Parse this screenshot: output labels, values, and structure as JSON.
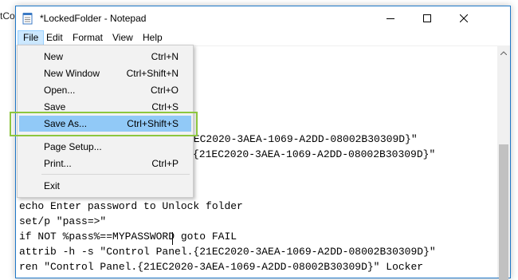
{
  "background": {
    "text": "tCo"
  },
  "window": {
    "title": "*LockedFolder - Notepad",
    "controls": {
      "minimize": "—",
      "maximize": "☐",
      "close": "✕"
    }
  },
  "menubar": {
    "items": [
      "File",
      "Edit",
      "Format",
      "View",
      "Help"
    ],
    "active": "File"
  },
  "file_menu": {
    "items": [
      {
        "label": "New",
        "shortcut": "Ctrl+N"
      },
      {
        "label": "New Window",
        "shortcut": "Ctrl+Shift+N"
      },
      {
        "label": "Open...",
        "shortcut": "Ctrl+O"
      },
      {
        "label": "Save",
        "shortcut": "Ctrl+S"
      },
      {
        "label": "Save As...",
        "shortcut": "Ctrl+Shift+S"
      },
      {
        "label": "Page Setup...",
        "shortcut": ""
      },
      {
        "label": "Print...",
        "shortcut": "Ctrl+P"
      },
      {
        "label": "Exit",
        "shortcut": ""
      }
    ],
    "highlighted": "Save As..."
  },
  "editor": {
    "partial_lines": [
      "1EC2020-3AEA-1069-A2DD-08002B30309D}\"",
      "{21EC2020-3AEA-1069-A2DD-08002B30309D}\""
    ],
    "lines": [
      "echo Enter password to Unlock folder",
      "set/p \"pass=>\"",
      "if NOT %pass%==MYPASSWORD goto FAIL",
      "attrib -h -s \"Control Panel.{21EC2020-3AEA-1069-A2DD-08002B30309D}\"",
      "ren \"Control Panel.{21EC2020-3AEA-1069-A2DD-08002B30309D}\" Locker"
    ]
  },
  "colors": {
    "window_border": "#1e78c8",
    "menu_active": "#cce8ff",
    "item_highlight": "#91c9f7",
    "annotation_box": "#8dc63f"
  }
}
